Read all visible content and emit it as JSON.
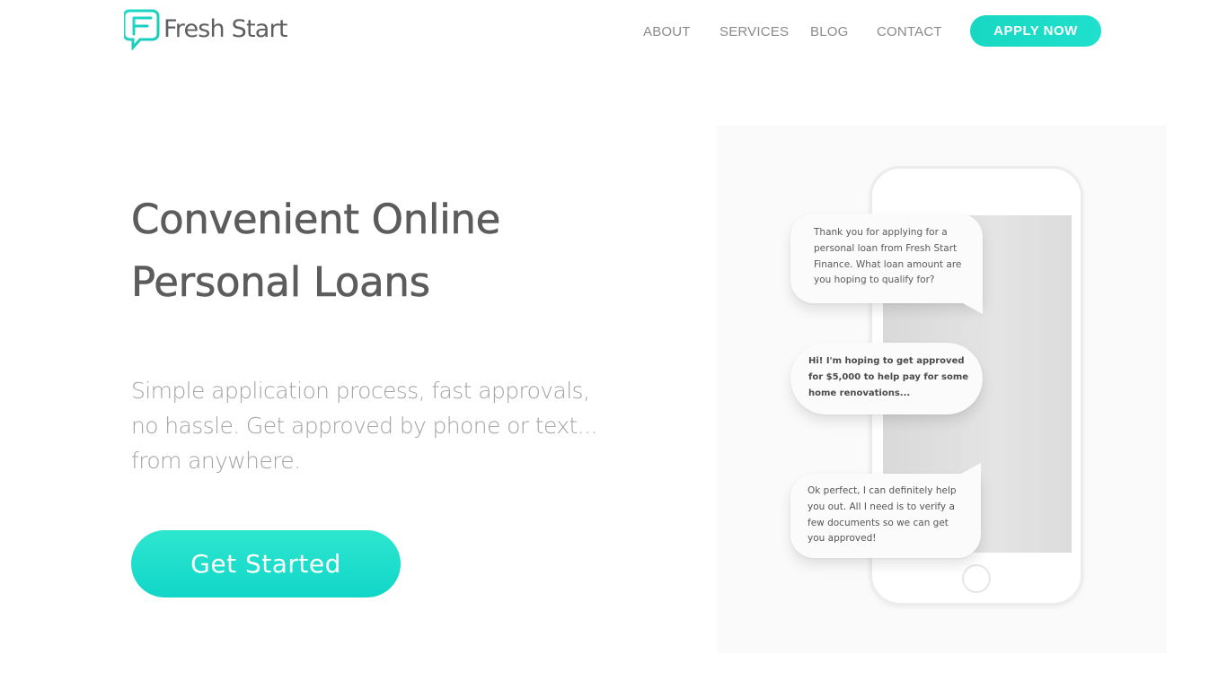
{
  "brand": {
    "name": "Fresh Start",
    "accent": "#1cdcc8",
    "text_color": "#5f5f5f"
  },
  "nav": {
    "items": [
      {
        "label": "ABOUT"
      },
      {
        "label": "SERVICES"
      },
      {
        "label": "BLOG"
      },
      {
        "label": "CONTACT"
      }
    ],
    "cta_label": "APPLY NOW"
  },
  "hero": {
    "title_lines": [
      "Convenient Online",
      "Personal Loans"
    ],
    "subtitle_lines": [
      "Simple application process, fast approvals,",
      "no hassle. Get approved by phone or text...",
      "from anywhere."
    ],
    "cta_label": "Get Started"
  },
  "chat": {
    "messages": [
      {
        "sender": "lender",
        "lines": [
          "Thank you for applying for a",
          "personal loan from Fresh Start",
          "Finance. What loan amount are",
          "you hoping to qualify for?"
        ]
      },
      {
        "sender": "customer",
        "lines": [
          "Hi! I'm hoping to get approved",
          "for $5,000 to help pay for some",
          "home renovations..."
        ]
      },
      {
        "sender": "lender",
        "lines": [
          "Ok perfect, I can definitely help",
          "you out. All I need is to verify a",
          "few documents so we can get",
          "you approved!"
        ]
      }
    ]
  }
}
